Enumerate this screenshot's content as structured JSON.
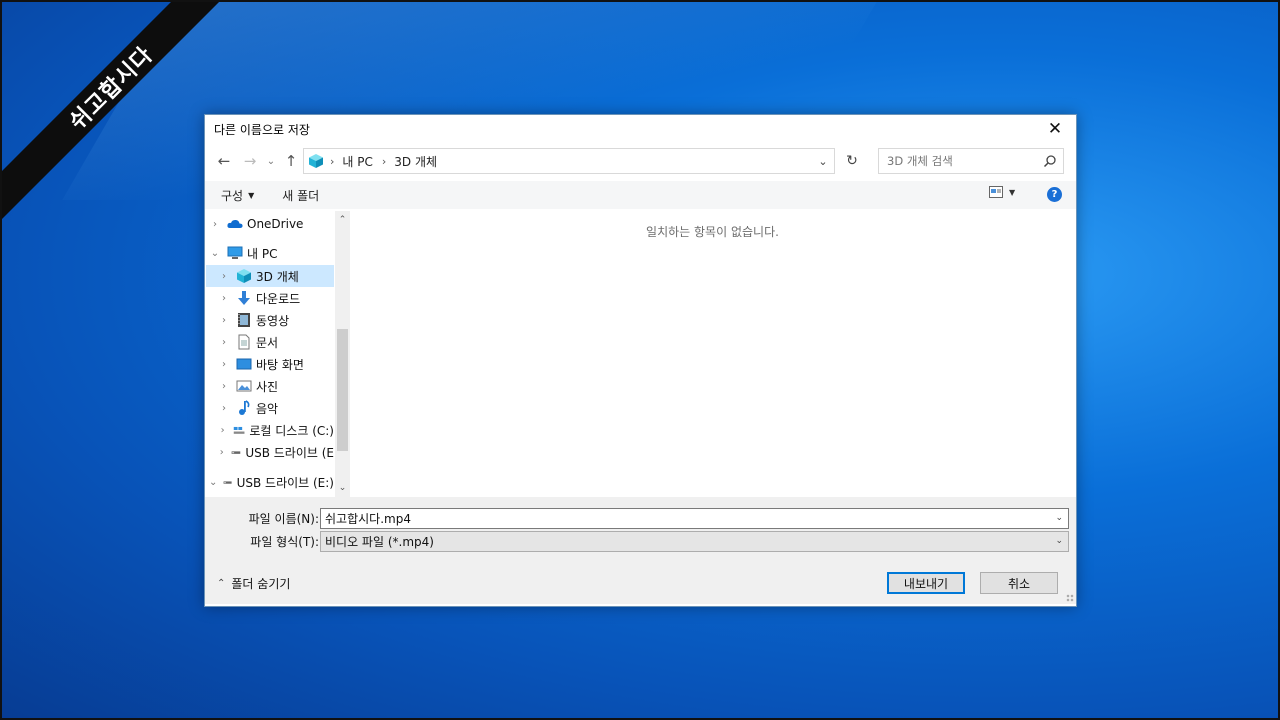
{
  "watermark": "쉬고합시다",
  "dialog": {
    "title": "다른 이름으로 저장",
    "address": [
      "내 PC",
      "3D 개체"
    ],
    "search_placeholder": "3D 개체 검색",
    "toolbar": {
      "organize": "구성",
      "new_folder": "새 폴더"
    },
    "sidebar": {
      "items": [
        {
          "label": "OneDrive",
          "icon": "cloud-icon",
          "expanded": false
        },
        {
          "label": "내 PC",
          "icon": "pc-icon",
          "expanded": true
        },
        {
          "label": "3D 개체",
          "icon": "3d-objects-icon",
          "selected": true
        },
        {
          "label": "다운로드",
          "icon": "download-icon"
        },
        {
          "label": "동영상",
          "icon": "video-icon"
        },
        {
          "label": "문서",
          "icon": "document-icon"
        },
        {
          "label": "바탕 화면",
          "icon": "desktop-icon"
        },
        {
          "label": "사진",
          "icon": "picture-icon"
        },
        {
          "label": "음악",
          "icon": "music-icon"
        },
        {
          "label": "로컬 디스크 (C:)",
          "icon": "local-disk-icon"
        },
        {
          "label": "USB 드라이브 (E",
          "icon": "usb-drive-icon"
        },
        {
          "label": "USB 드라이브 (E:)",
          "icon": "usb-drive-icon",
          "expanded": true
        }
      ]
    },
    "empty_message": "일치하는 항목이 없습니다.",
    "file_name_label": "파일 이름(N):",
    "file_name_value": "쉬고합시다.mp4",
    "file_type_label": "파일 형식(T):",
    "file_type_value": "비디오 파일 (*.mp4)",
    "hide_folders": "폴더 숨기기",
    "export_button": "내보내기",
    "cancel_button": "취소",
    "accent_color": "#0078d7",
    "selection_color": "#cce8ff"
  }
}
